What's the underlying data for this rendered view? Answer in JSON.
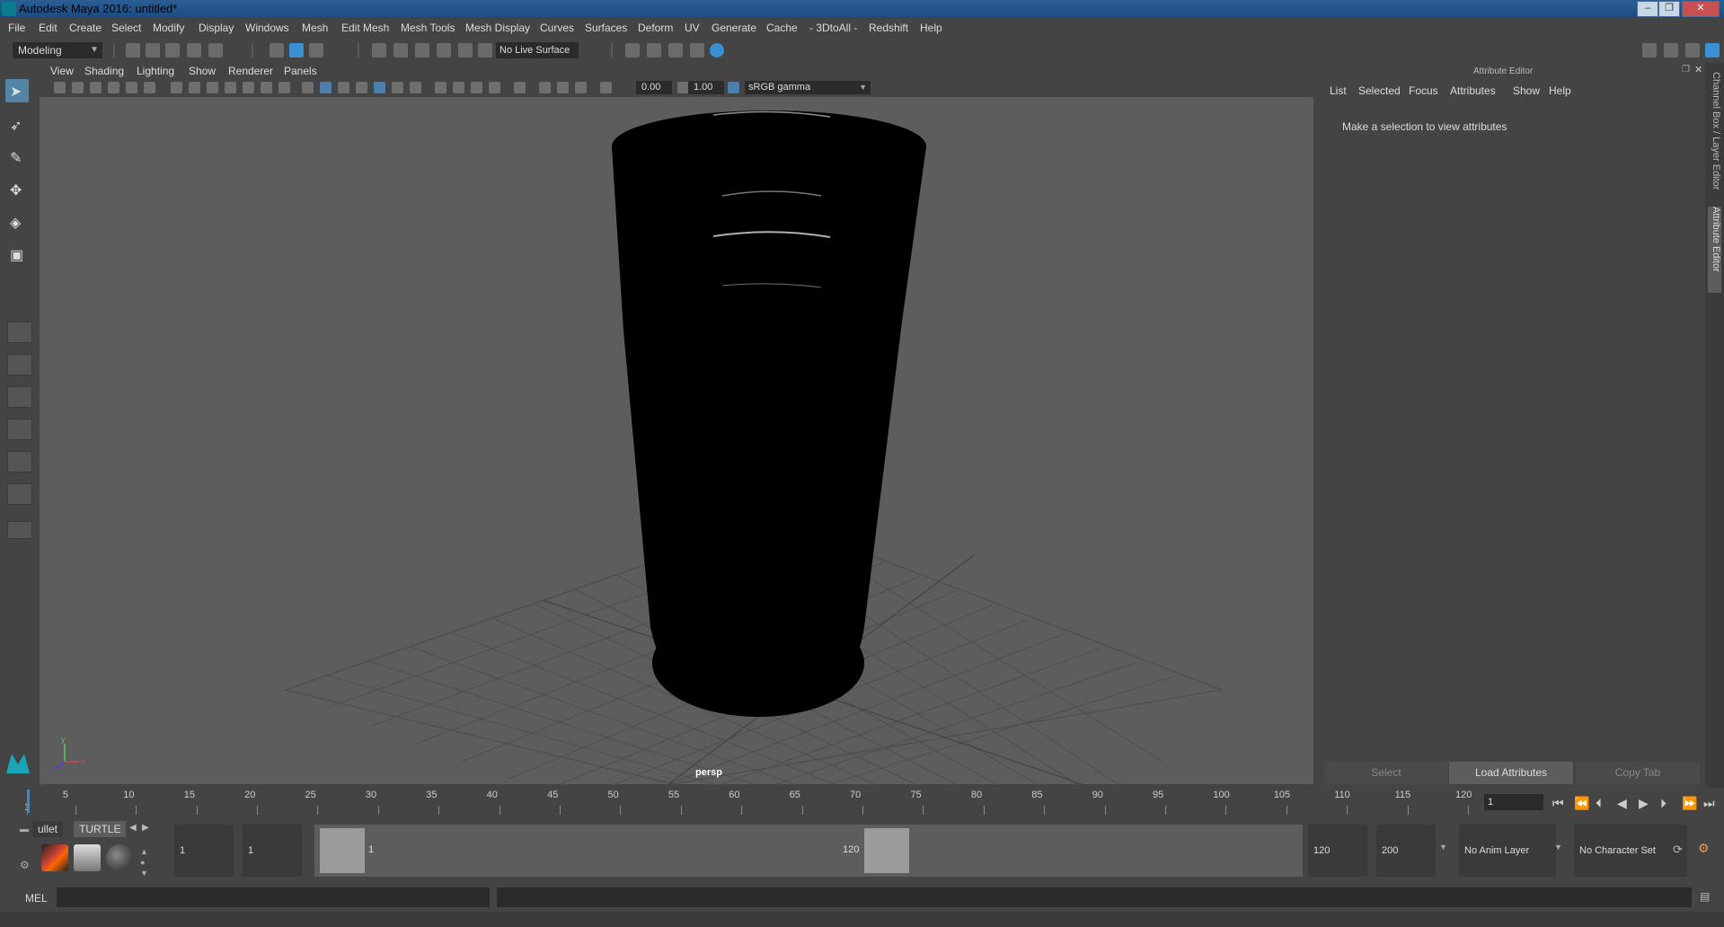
{
  "window": {
    "title": "Autodesk Maya 2016: untitled*",
    "minimize": "–",
    "maximize": "❐",
    "close": "✕"
  },
  "menu": [
    "File",
    "Edit",
    "Create",
    "Select",
    "Modify",
    "Display",
    "Windows",
    "Mesh",
    "Edit Mesh",
    "Mesh Tools",
    "Mesh Display",
    "Curves",
    "Surfaces",
    "Deform",
    "UV",
    "Generate",
    "Cache",
    "- 3DtoAll -",
    "Redshift",
    "Help"
  ],
  "toolbar": {
    "mode": "Modeling",
    "live_surface": "No Live Surface"
  },
  "panel_menu": [
    "View",
    "Shading",
    "Lighting",
    "Show",
    "Renderer",
    "Panels"
  ],
  "panel_toolbar": {
    "exposure": "0.00",
    "gamma_value": "1.00",
    "color_space": "sRGB gamma"
  },
  "viewport": {
    "camera_label": "persp",
    "axis_x": "x",
    "axis_y": "y",
    "axis_z": "z"
  },
  "attribute_editor": {
    "heading": "Attribute Editor",
    "menu": [
      "List",
      "Selected",
      "Focus",
      "Attributes",
      "Show",
      "Help"
    ],
    "message": "Make a selection to view attributes",
    "buttons": {
      "select": "Select",
      "load": "Load Attributes",
      "copy_tab": "Copy Tab"
    }
  },
  "side_tabs": {
    "channel_box": "Channel Box / Layer Editor",
    "attribute_editor": "Attribute Editor"
  },
  "time_slider": {
    "ticks": [
      "1",
      "5",
      "10",
      "15",
      "20",
      "25",
      "30",
      "35",
      "40",
      "45",
      "50",
      "55",
      "60",
      "65",
      "70",
      "75",
      "80",
      "85",
      "90",
      "95",
      "100",
      "105",
      "110",
      "115",
      "120"
    ],
    "current_frame": "1"
  },
  "shelf": {
    "tabs": [
      "ullet",
      "TURTLE"
    ]
  },
  "range": {
    "start": "1",
    "playback_start": "1",
    "slider_start": "1",
    "slider_end": "120",
    "playback_end": "120",
    "end": "200"
  },
  "anim": {
    "layer": "No Anim Layer",
    "character_set": "No Character Set"
  },
  "command_line": {
    "label": "MEL"
  },
  "colors": {
    "accent": "#5285a6",
    "viewport_bg": "#5d5d5d",
    "title_bar": "#1c4b80"
  }
}
